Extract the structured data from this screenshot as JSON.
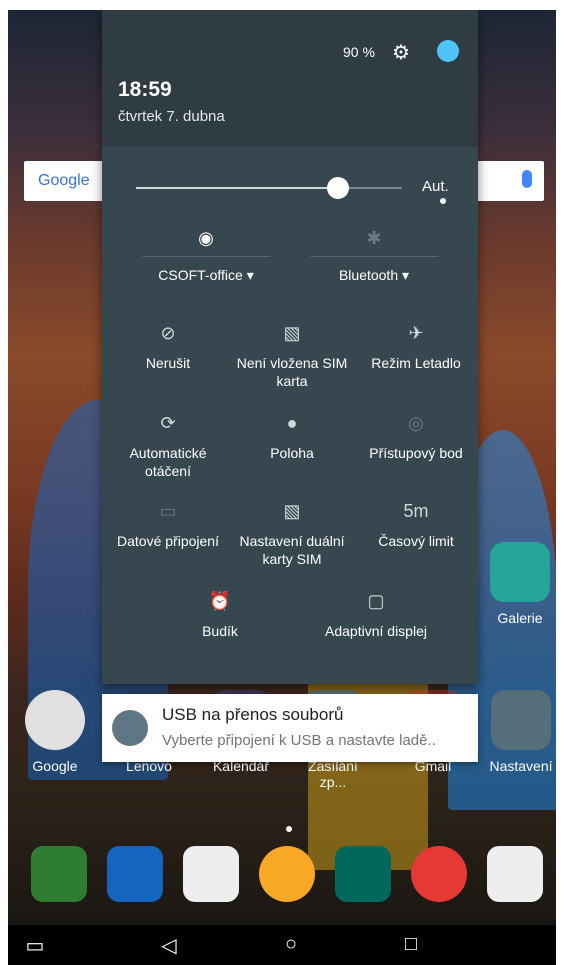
{
  "status": {
    "time": "18:59",
    "date": "čtvrtek 7. dubna",
    "battery": "90 %"
  },
  "brightness": {
    "level": 0.76,
    "auto_label": "Aut."
  },
  "top_toggles": [
    {
      "label": "CSOFT-office",
      "icon": "wifi-icon",
      "glyph": "◉"
    },
    {
      "label": "Bluetooth",
      "icon": "bluetooth-icon",
      "glyph": "✱"
    }
  ],
  "tiles": [
    {
      "name": "tile-nerusit",
      "label": "Nerušit",
      "icon": "do-not-disturb-icon",
      "glyph": "⊘",
      "dim": false
    },
    {
      "name": "tile-sim",
      "label": "Není vložena SIM karta",
      "icon": "no-sim-icon",
      "glyph": "▧",
      "dim": false
    },
    {
      "name": "tile-airplane",
      "label": "Režim Letadlo",
      "icon": "airplane-icon",
      "glyph": "✈",
      "dim": false
    },
    {
      "name": "tile-rotation",
      "label": "Automatické otáčení",
      "icon": "rotation-icon",
      "glyph": "⟳",
      "dim": false
    },
    {
      "name": "tile-location",
      "label": "Poloha",
      "icon": "location-icon",
      "glyph": "●",
      "dim": false
    },
    {
      "name": "tile-hotspot",
      "label": "Přístupový bod",
      "icon": "hotspot-icon",
      "glyph": "◎",
      "dim": true
    },
    {
      "name": "tile-data",
      "label": "Datové připojení",
      "icon": "data-icon",
      "glyph": "▭",
      "dim": true
    },
    {
      "name": "tile-dual-sim",
      "label": "Nastavení duální karty SIM",
      "icon": "dual-sim-icon",
      "glyph": "▧",
      "dim": false
    },
    {
      "name": "tile-timeout",
      "label": "Časový limit",
      "icon": "timer-icon",
      "glyph": "5m",
      "dim": false
    },
    {
      "name": "tile-alarm",
      "label": "Budík",
      "icon": "alarm-icon",
      "glyph": "⏰",
      "dim": true
    },
    {
      "name": "tile-display",
      "label": "Adaptivní displej",
      "icon": "display-icon",
      "glyph": "▢",
      "dim": false
    }
  ],
  "notification": {
    "title": "USB na přenos souborů",
    "text": "Vyberte připojení k USB a nastavte ladě.."
  },
  "home": {
    "search": "Google",
    "apps": [
      {
        "name": "app-galerie",
        "label": "Galerie",
        "color": "#26a69a"
      },
      {
        "name": "app-google",
        "label": "Google",
        "color": "#e0e0e0"
      },
      {
        "name": "app-lenovo",
        "label": "Lenovo",
        "color": "#2c3e50"
      },
      {
        "name": "app-kalendar",
        "label": "Kalendář",
        "color": "#3f51b5"
      },
      {
        "name": "app-zasilani",
        "label": "Zasílání zp...",
        "color": "#1e88e5"
      },
      {
        "name": "app-gmail",
        "label": "Gmail",
        "color": "#e53935"
      },
      {
        "name": "app-nastaveni",
        "label": "Nastavení",
        "color": "#546e7a"
      }
    ],
    "dock": [
      {
        "name": "dock-phone",
        "color": "#2e7d32"
      },
      {
        "name": "dock-contacts",
        "color": "#1565c0"
      },
      {
        "name": "dock-camera",
        "color": "#eeeeee"
      },
      {
        "name": "dock-apps",
        "color": "#f9a825"
      },
      {
        "name": "dock-dolby",
        "color": "#00695c"
      },
      {
        "name": "dock-chrome",
        "color": "#e53935"
      },
      {
        "name": "dock-store",
        "color": "#eeeeee"
      }
    ]
  }
}
